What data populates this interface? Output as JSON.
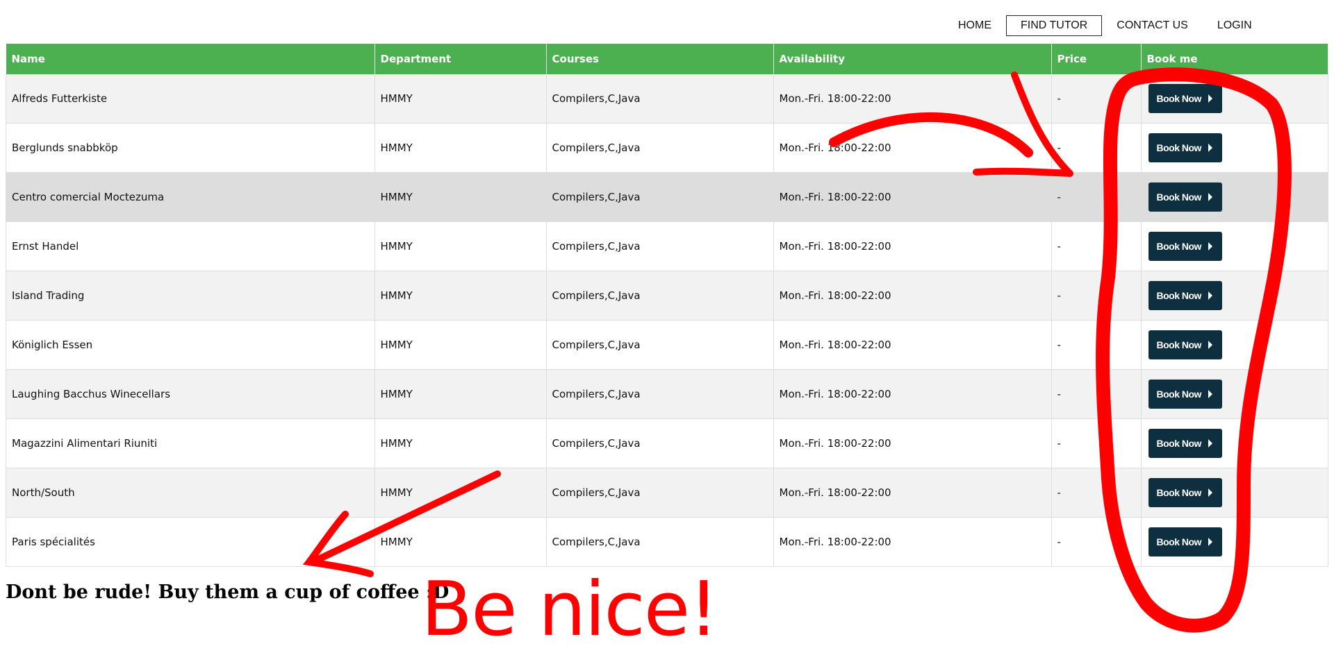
{
  "nav": {
    "items": [
      {
        "label": "HOME",
        "active": false
      },
      {
        "label": "FIND TUTOR",
        "active": true
      },
      {
        "label": "CONTACT US",
        "active": false
      },
      {
        "label": "LOGIN",
        "active": false
      }
    ]
  },
  "table": {
    "headers": [
      "Name",
      "Department",
      "Courses",
      "Availability",
      "Price",
      "Book me"
    ],
    "book_label": "Book Now",
    "rows": [
      {
        "name": "Alfreds Futterkiste",
        "department": "HMMY",
        "courses": "Compilers,C,Java",
        "availability": "Mon.-Fri. 18:00-22:00",
        "price": "-"
      },
      {
        "name": "Berglunds snabbköp",
        "department": "HMMY",
        "courses": "Compilers,C,Java",
        "availability": "Mon.-Fri. 18:00-22:00",
        "price": "-"
      },
      {
        "name": "Centro comercial Moctezuma",
        "department": "HMMY",
        "courses": "Compilers,C,Java",
        "availability": "Mon.-Fri. 18:00-22:00",
        "price": "-"
      },
      {
        "name": "Ernst Handel",
        "department": "HMMY",
        "courses": "Compilers,C,Java",
        "availability": "Mon.-Fri. 18:00-22:00",
        "price": "-"
      },
      {
        "name": "Island Trading",
        "department": "HMMY",
        "courses": "Compilers,C,Java",
        "availability": "Mon.-Fri. 18:00-22:00",
        "price": "-"
      },
      {
        "name": "Königlich Essen",
        "department": "HMMY",
        "courses": "Compilers,C,Java",
        "availability": "Mon.-Fri. 18:00-22:00",
        "price": "-"
      },
      {
        "name": "Laughing Bacchus Winecellars",
        "department": "HMMY",
        "courses": "Compilers,C,Java",
        "availability": "Mon.-Fri. 18:00-22:00",
        "price": "-"
      },
      {
        "name": "Magazzini Alimentari Riuniti",
        "department": "HMMY",
        "courses": "Compilers,C,Java",
        "availability": "Mon.-Fri. 18:00-22:00",
        "price": "-"
      },
      {
        "name": "North/South",
        "department": "HMMY",
        "courses": "Compilers,C,Java",
        "availability": "Mon.-Fri. 18:00-22:00",
        "price": "-"
      },
      {
        "name": "Paris spécialités",
        "department": "HMMY",
        "courses": "Compilers,C,Java",
        "availability": "Mon.-Fri. 18:00-22:00",
        "price": "-"
      }
    ]
  },
  "footer": {
    "message": "Dont be rude! Buy them a cup of coffee :D"
  },
  "annotation": {
    "text": "Be nice!"
  },
  "colors": {
    "header_green": "#4caf50",
    "button_navy": "#0d2f40",
    "annotation_red": "#ff0000"
  }
}
